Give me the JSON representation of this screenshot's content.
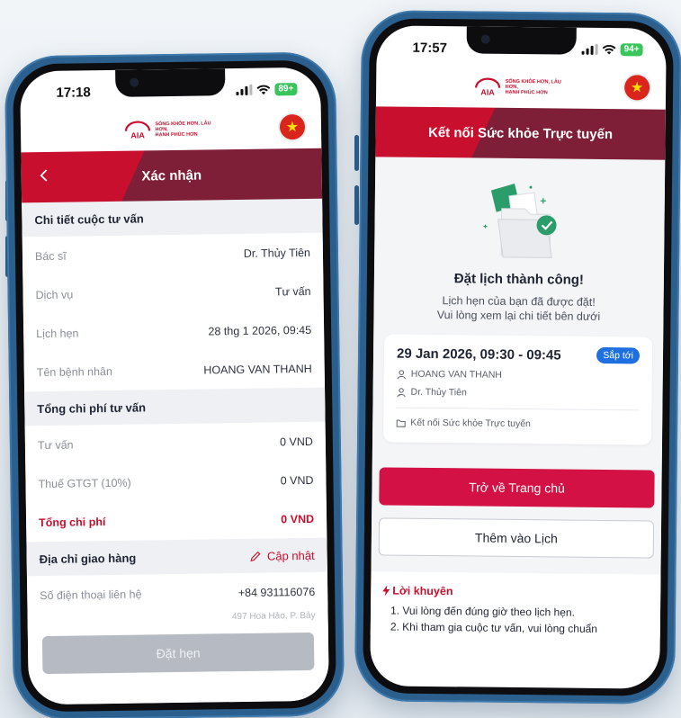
{
  "phone1": {
    "status": {
      "time": "17:18",
      "battery": "89+"
    },
    "header": {
      "title": "Xác nhận",
      "back_icon": "chevron-left-icon"
    },
    "consult": {
      "title": "Chi tiết cuộc tư vấn",
      "rows": [
        {
          "label": "Bác sĩ",
          "value": "Dr. Thủy Tiên"
        },
        {
          "label": "Dịch vụ",
          "value": "Tư vấn"
        },
        {
          "label": "Lịch hẹn",
          "value": "28 thg 1 2026, 09:45"
        },
        {
          "label": "Tên bệnh nhân",
          "value": "HOANG VAN THANH"
        }
      ]
    },
    "cost": {
      "title": "Tổng chi phí tư vấn",
      "rows": [
        {
          "label": "Tư vấn",
          "value": "0 VND"
        },
        {
          "label": "Thuế GTGT (10%)",
          "value": "0 VND"
        }
      ],
      "total_label": "Tổng chi phí",
      "total_value": "0 VND"
    },
    "delivery": {
      "title": "Địa chỉ giao hàng",
      "update_label": "Cập nhật",
      "phone_label": "Số điện thoại liên hệ",
      "phone_value": "+84 931116076",
      "address_peek": "497 Hoa Hảo, P. Bảy"
    },
    "submit_label": "Đặt hẹn"
  },
  "phone2": {
    "status": {
      "time": "17:57",
      "battery": "94+"
    },
    "header": {
      "title": "Kết nối Sức khỏe Trực tuyến"
    },
    "success": {
      "title": "Đặt lịch thành công!",
      "line1": "Lịch hẹn của bạn đã được đặt!",
      "line2": "Vui lòng xem lại chi tiết bên dưới"
    },
    "appointment": {
      "time": "29 Jan 2026, 09:30 - 09:45",
      "badge": "Sắp tới",
      "patient": "HOANG VAN THANH",
      "doctor": "Dr. Thủy Tiên",
      "service": "Kết nối Sức khỏe Trực tuyến"
    },
    "home_button": "Trở về Trang chủ",
    "calendar_button": "Thêm vào Lịch",
    "advice": {
      "title": "Lời khuyên",
      "items": [
        "1. Vui lòng đến đúng giờ theo lịch hẹn.",
        "2. Khi tham gia cuộc tư vấn, vui lòng chuẩn"
      ]
    }
  },
  "brand": {
    "tagline_1": "SỐNG KHỎE HƠN, LÂU HƠN,",
    "tagline_2": "HẠNH PHÚC HƠN",
    "accent": "#c8102e",
    "accent_dark": "#7f1f37"
  }
}
